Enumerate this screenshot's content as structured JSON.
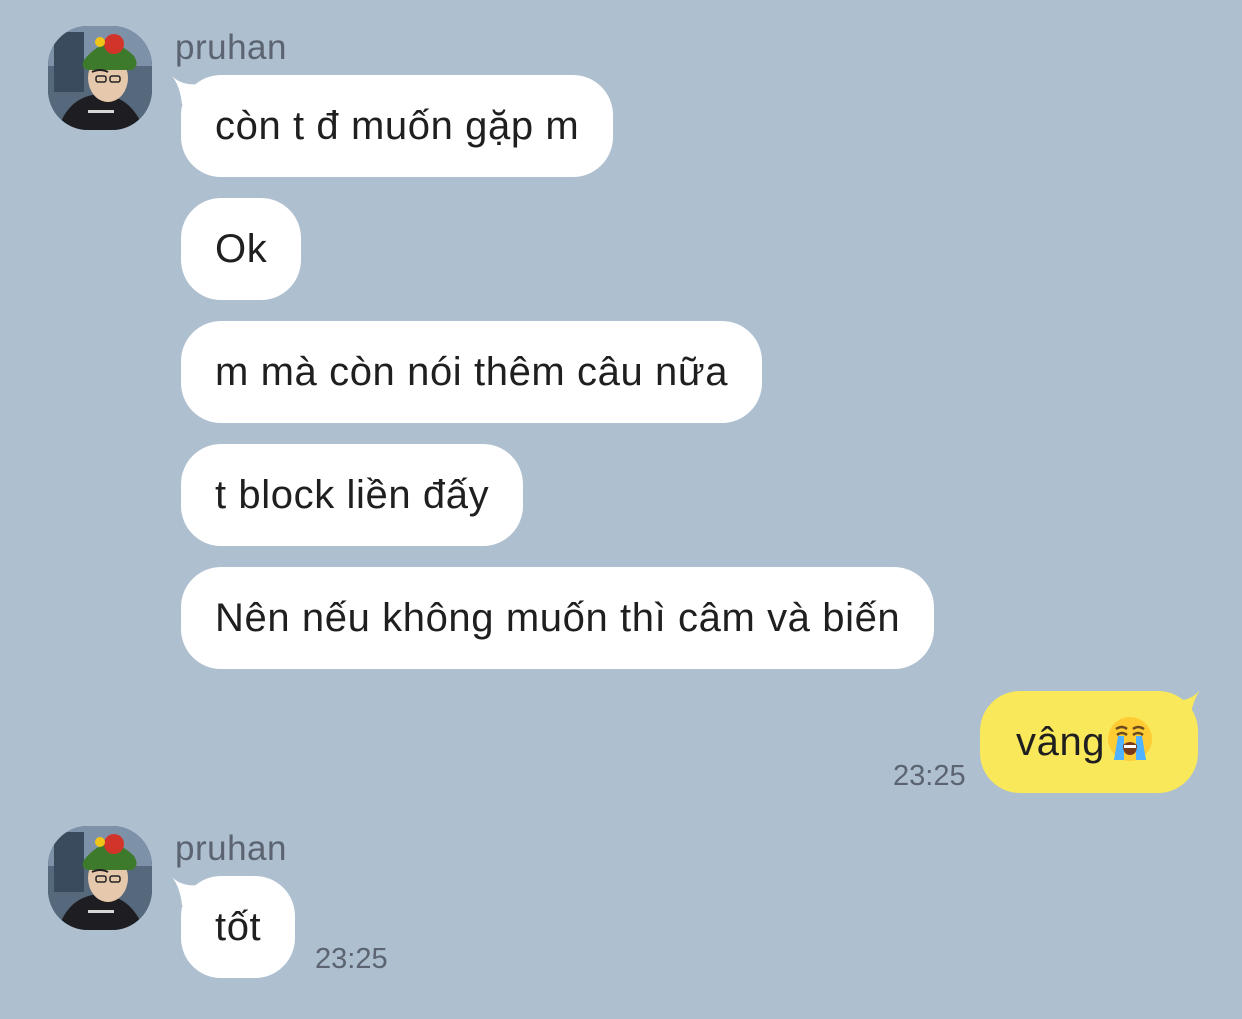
{
  "colors": {
    "background": "#aebfd0",
    "incoming_bubble": "#ffffff",
    "outgoing_bubble": "#f8e85a",
    "meta_text": "#5b6470"
  },
  "group1": {
    "sender": "pruhan",
    "messages": [
      "còn t đ muốn gặp m",
      "Ok",
      "m mà còn nói thêm câu nữa",
      "t block liền đấy",
      "Nên nếu không muốn thì câm và biến"
    ]
  },
  "outgoing": {
    "text": "vâng",
    "emoji": "loudly-crying-face-icon",
    "time": "23:25"
  },
  "group2": {
    "sender": "pruhan",
    "messages": [
      "tốt"
    ],
    "time": "23:25"
  }
}
